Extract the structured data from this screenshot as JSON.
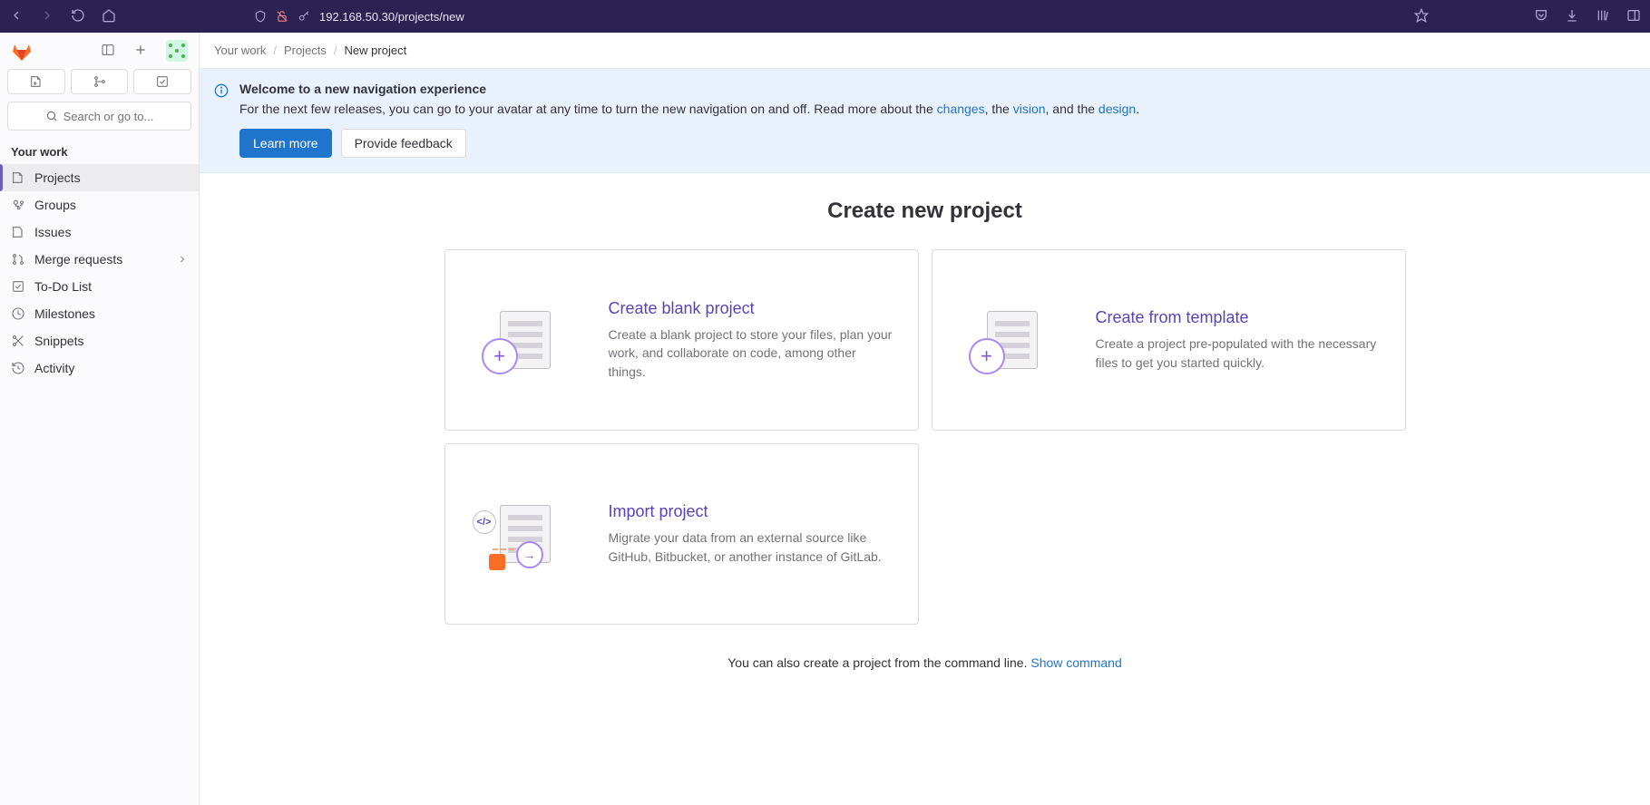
{
  "browser": {
    "url": "192.168.50.30/projects/new"
  },
  "sidebar": {
    "search_placeholder": "Search or go to...",
    "heading": "Your work",
    "items": [
      {
        "label": "Projects"
      },
      {
        "label": "Groups"
      },
      {
        "label": "Issues"
      },
      {
        "label": "Merge requests"
      },
      {
        "label": "To-Do List"
      },
      {
        "label": "Milestones"
      },
      {
        "label": "Snippets"
      },
      {
        "label": "Activity"
      }
    ]
  },
  "breadcrumb": {
    "a": "Your work",
    "b": "Projects",
    "c": "New project"
  },
  "banner": {
    "title": "Welcome to a new navigation experience",
    "text_pre": "For the next few releases, you can go to your avatar at any time to turn the new navigation on and off. Read more about the ",
    "link1": "changes",
    "text_mid1": ", the ",
    "link2": "vision",
    "text_mid2": ", and the ",
    "link3": "design",
    "text_post": ".",
    "learn_more": "Learn more",
    "feedback": "Provide feedback"
  },
  "page": {
    "title": "Create new project",
    "cards": {
      "blank": {
        "title": "Create blank project",
        "desc": "Create a blank project to store your files, plan your work, and collaborate on code, among other things."
      },
      "template": {
        "title": "Create from template",
        "desc": "Create a project pre-populated with the necessary files to get you started quickly."
      },
      "import": {
        "title": "Import project",
        "desc": "Migrate your data from an external source like GitHub, Bitbucket, or another instance of GitLab."
      }
    },
    "cli_text": "You can also create a project from the command line. ",
    "cli_link": "Show command"
  }
}
